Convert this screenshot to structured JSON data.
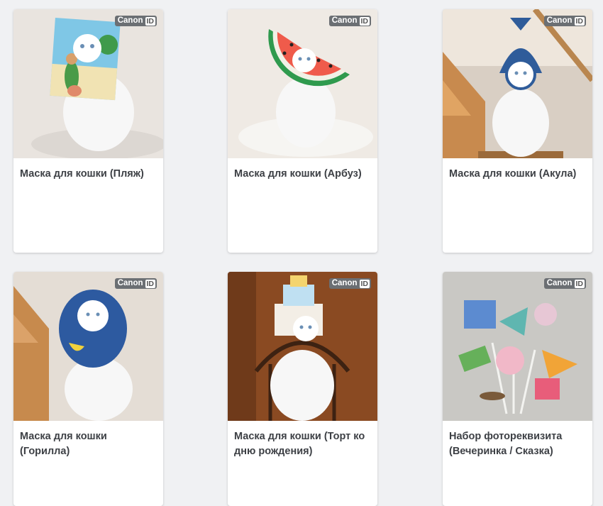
{
  "badge": {
    "brand": "Canon",
    "id": "ID"
  },
  "cards": [
    {
      "title": "Маска для кошки (Пляж)",
      "image": "cat-beach-mask-photo"
    },
    {
      "title": "Маска для кошки (Арбуз)",
      "image": "cat-watermelon-mask-photo"
    },
    {
      "title": "Маска для кошки (Акула)",
      "image": "cat-shark-mask-photo"
    },
    {
      "title": "Маска для кошки (Горилла)",
      "image": "cat-gorilla-mask-photo"
    },
    {
      "title": "Маска для кошки (Торт ко дню рождения)",
      "image": "cat-birthday-cake-mask-photo"
    },
    {
      "title": "Набор фотореквизита (Вечеринка / Сказка)",
      "image": "party-photo-props-photo"
    }
  ]
}
